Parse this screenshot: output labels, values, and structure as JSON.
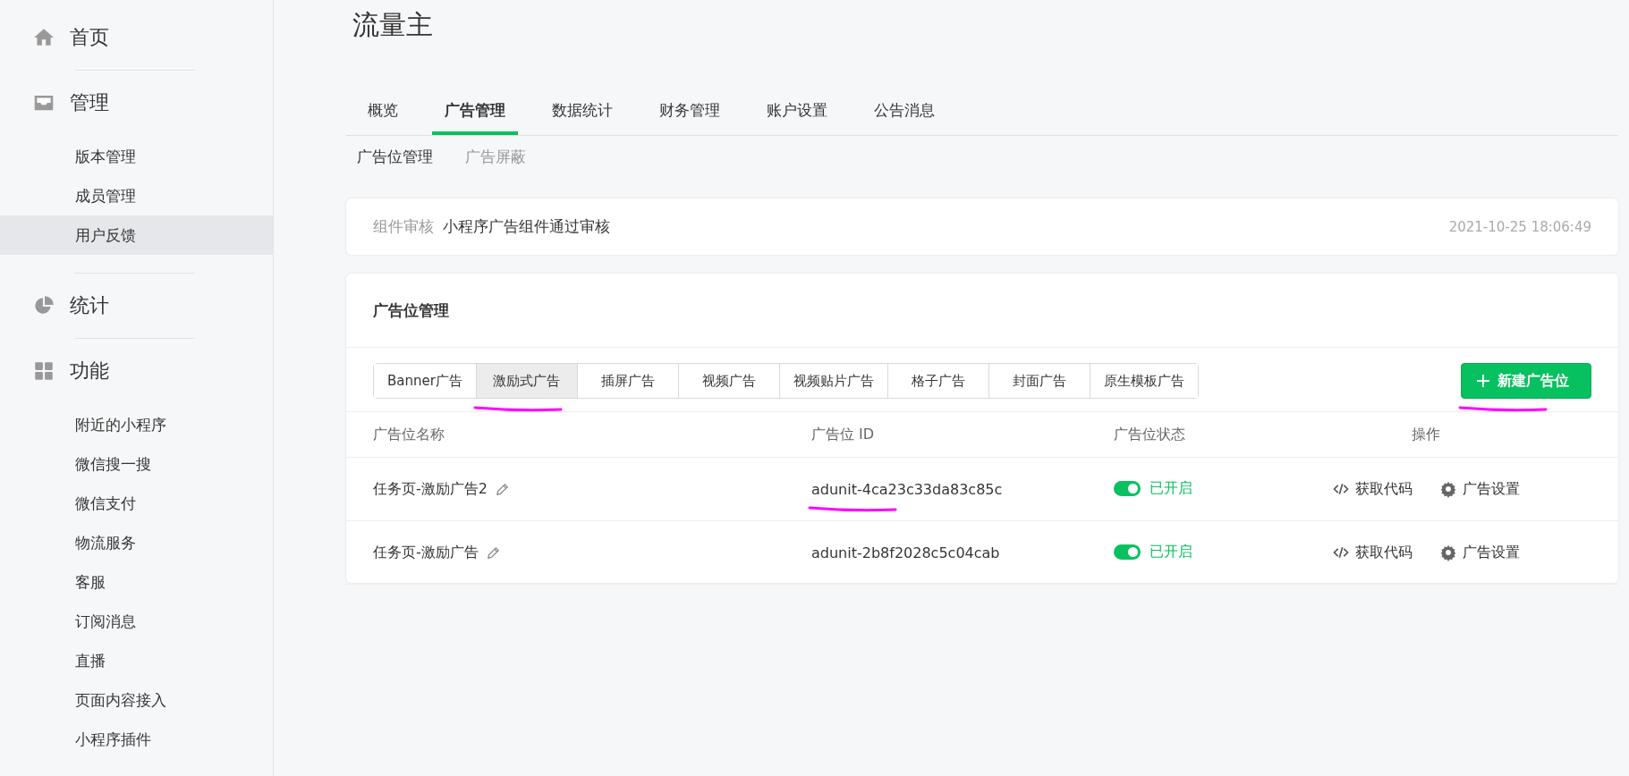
{
  "sidebar": {
    "groups": [
      {
        "kind": "home",
        "label": "首页"
      },
      {
        "kind": "inbox",
        "label": "管理",
        "items": [
          {
            "label": "版本管理",
            "selected": false
          },
          {
            "label": "成员管理",
            "selected": false
          },
          {
            "label": "用户反馈",
            "selected": true
          }
        ]
      },
      {
        "kind": "pie",
        "label": "统计"
      },
      {
        "kind": "grid",
        "label": "功能",
        "items": [
          {
            "label": "附近的小程序",
            "selected": false
          },
          {
            "label": "微信搜一搜",
            "selected": false
          },
          {
            "label": "微信支付",
            "selected": false
          },
          {
            "label": "物流服务",
            "selected": false
          },
          {
            "label": "客服",
            "selected": false
          },
          {
            "label": "订阅消息",
            "selected": false
          },
          {
            "label": "直播",
            "selected": false
          },
          {
            "label": "页面内容接入",
            "selected": false
          },
          {
            "label": "小程序插件",
            "selected": false
          }
        ]
      }
    ]
  },
  "page_title": "流量主",
  "tabs": [
    {
      "label": "概览",
      "selected": false
    },
    {
      "label": "广告管理",
      "selected": true
    },
    {
      "label": "数据统计",
      "selected": false
    },
    {
      "label": "财务管理",
      "selected": false
    },
    {
      "label": "账户设置",
      "selected": false
    },
    {
      "label": "公告消息",
      "selected": false
    }
  ],
  "subtabs": [
    {
      "label": "广告位管理",
      "selected": true
    },
    {
      "label": "广告屏蔽",
      "selected": false
    }
  ],
  "notice": {
    "label": "组件审核",
    "text": "小程序广告组件通过审核",
    "time": "2021-10-25 18:06:49"
  },
  "panel": {
    "title": "广告位管理",
    "segments": [
      {
        "label": "Banner广告",
        "selected": false,
        "underlined": false
      },
      {
        "label": "激励式广告",
        "selected": true,
        "underlined": true
      },
      {
        "label": "插屏广告",
        "selected": false,
        "underlined": false
      },
      {
        "label": "视频广告",
        "selected": false,
        "underlined": false
      },
      {
        "label": "视频贴片广告",
        "selected": false,
        "underlined": false
      },
      {
        "label": "格子广告",
        "selected": false,
        "underlined": false
      },
      {
        "label": "封面广告",
        "selected": false,
        "underlined": false
      },
      {
        "label": "原生模板广告",
        "selected": false,
        "underlined": false
      }
    ],
    "new_button": {
      "label": "新建广告位",
      "underlined": true
    },
    "columns": [
      "广告位名称",
      "广告位 ID",
      "广告位状态",
      "操作"
    ],
    "rows": [
      {
        "name": "任务页-激励广告2",
        "id": "adunit-4ca23c33da83c85c",
        "id_underlined": true,
        "on": true,
        "status": "已开启",
        "actions": [
          "获取代码",
          "广告设置"
        ]
      },
      {
        "name": "任务页-激励广告",
        "id": "adunit-2b8f2028c5c04cab",
        "id_underlined": false,
        "on": true,
        "status": "已开启",
        "actions": [
          "获取代码",
          "广告设置"
        ]
      }
    ]
  }
}
